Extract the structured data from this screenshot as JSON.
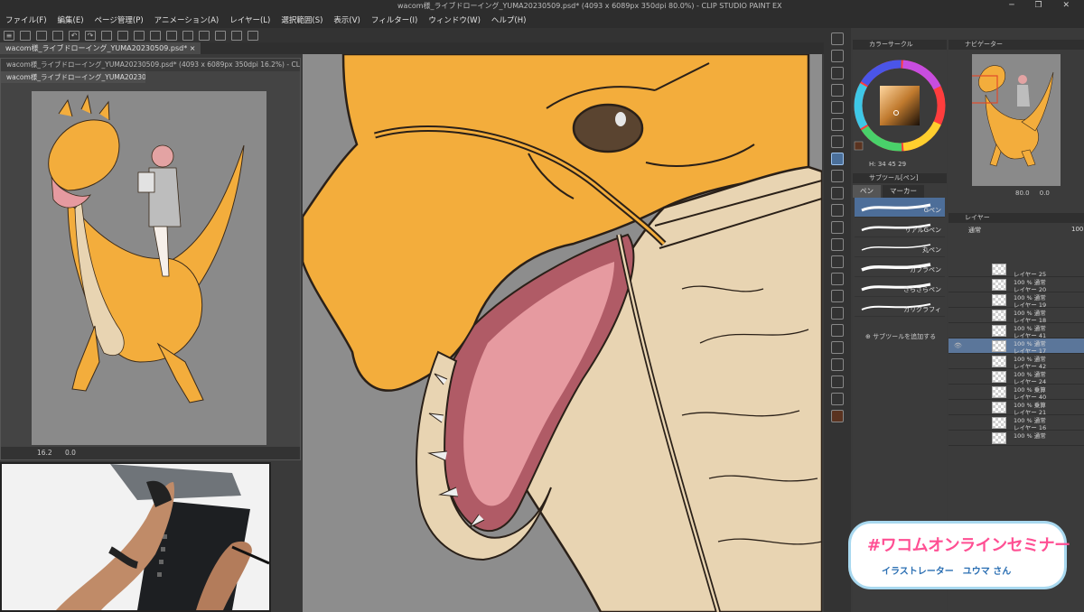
{
  "window": {
    "title": "wacom様_ライブドローイング_YUMA20230509.psd* (4093 x 6089px 350dpi 80.0%) - CLIP STUDIO PAINT EX",
    "controls": "─ ❐ ✕"
  },
  "menu": [
    "ファイル(F)",
    "編集(E)",
    "ページ管理(P)",
    "アニメーション(A)",
    "レイヤー(L)",
    "選択範囲(S)",
    "表示(V)",
    "フィルター(I)",
    "ウィンドウ(W)",
    "ヘルプ(H)"
  ],
  "document_tab": "wacom様_ライブドローイング_YUMA20230509.psd* ×",
  "subwindow": {
    "title": "wacom様_ライブドローイング_YUMA20230509.psd* (4093 x 6089px 350dpi 16.2%) - CLIP STU",
    "tab": "wacom様_ライブドローイング_YUMA20230509.psd* ×",
    "zoom": "16.2",
    "angle": "0.0"
  },
  "color_panel": {
    "title": "カラーサークル",
    "readout": "H: 34  45  29"
  },
  "subtool_panel": {
    "title": "サブツール[ペン]",
    "tabs": [
      "ペン",
      "マーカー"
    ],
    "brushes": [
      "Gペン",
      "リアルGペン",
      "丸ペン",
      "カブラペン",
      "さらさらペン",
      "カリグラフィ"
    ],
    "add_label": "サブツールを追加する"
  },
  "navigator": {
    "title": "ナビゲーター",
    "zoom": "80.0",
    "angle": "0.0"
  },
  "layer_panel": {
    "title": "レイヤー",
    "blend_mode": "通常",
    "opacity": "100",
    "layers": [
      {
        "mode": "",
        "name": "レイヤー 25",
        "selected": false
      },
      {
        "mode": "100 % 通常",
        "name": "レイヤー 20",
        "selected": false
      },
      {
        "mode": "100 % 通常",
        "name": "レイヤー 19",
        "selected": false
      },
      {
        "mode": "100 % 通常",
        "name": "レイヤー 18",
        "selected": false
      },
      {
        "mode": "100 % 通常",
        "name": "レイヤー 41",
        "selected": false
      },
      {
        "mode": "100 % 通常",
        "name": "レイヤー 17",
        "selected": true
      },
      {
        "mode": "100 % 通常",
        "name": "レイヤー 42",
        "selected": false
      },
      {
        "mode": "100 % 通常",
        "name": "レイヤー 24",
        "selected": false
      },
      {
        "mode": "100 % 乗算",
        "name": "レイヤー 40",
        "selected": false
      },
      {
        "mode": "100 % 乗算",
        "name": "レイヤー 21",
        "selected": false
      },
      {
        "mode": "100 % 通常",
        "name": "レイヤー 16",
        "selected": false
      },
      {
        "mode": "100 % 通常",
        "name": "",
        "selected": false
      }
    ]
  },
  "seminar_badge": {
    "headline": "#ワコムオンラインセミナー",
    "presenter": "イラストレーター　ユウマ さん"
  },
  "colors": {
    "dragon_orange": "#f3ad3c",
    "mouth_pink": "#e69aa0",
    "gum_red": "#b05b66",
    "cream": "#e8d4b2",
    "canvas_gray": "#8d8d8d",
    "badge_pink": "#ff4f93",
    "badge_blue": "#2b6fb3"
  }
}
